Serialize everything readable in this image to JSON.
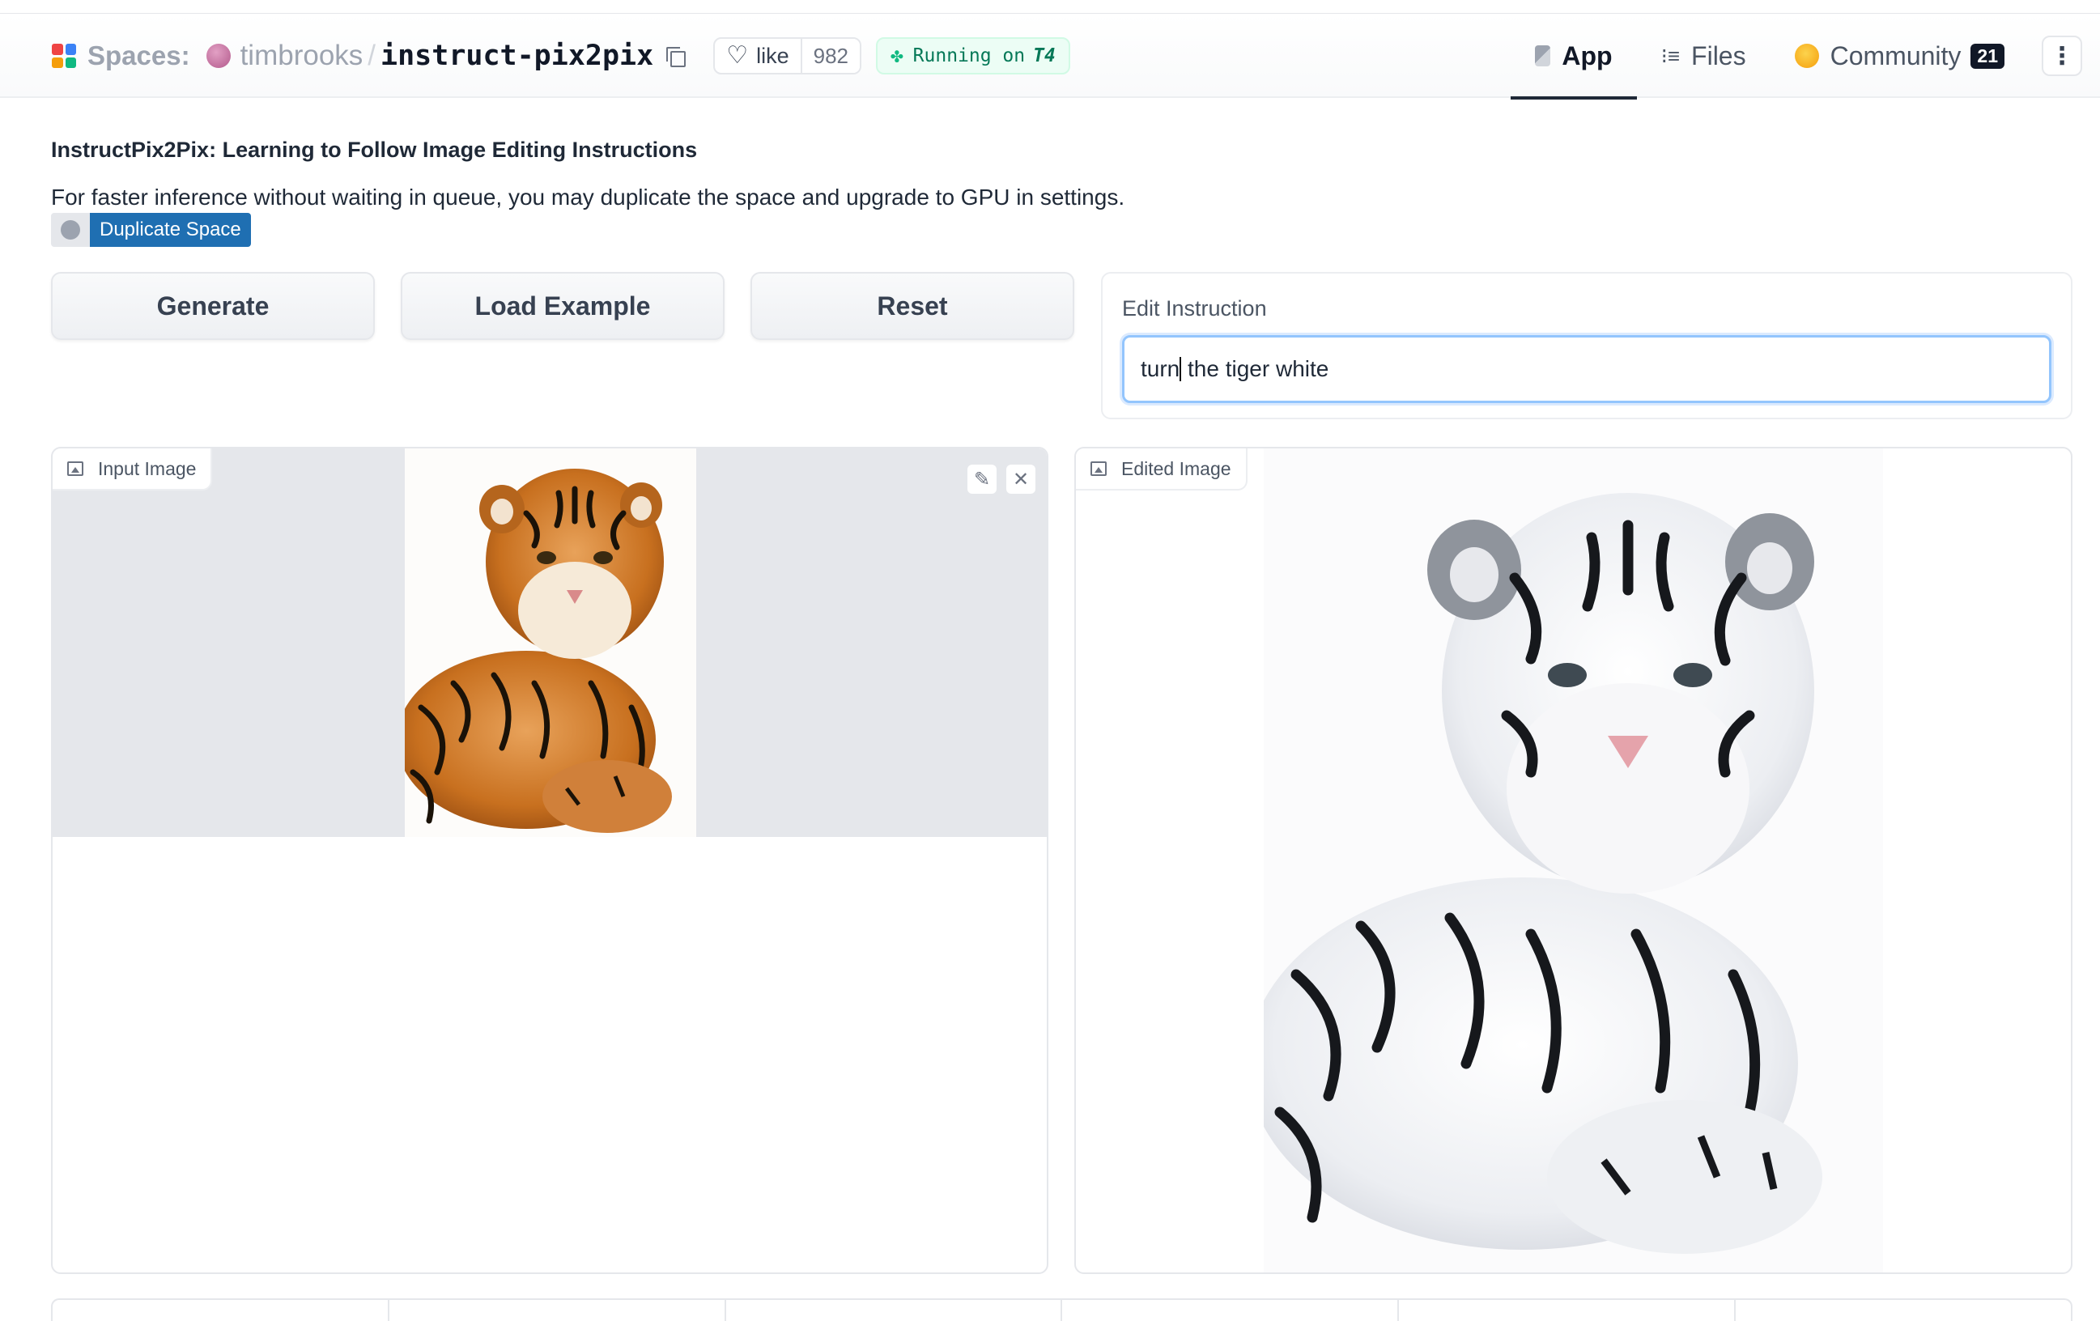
{
  "header": {
    "spaces_label": "Spaces:",
    "owner": "timbrooks",
    "separator": "/",
    "repo": "instruct-pix2pix",
    "like_label": "like",
    "like_count": "982",
    "running_label": "Running on",
    "hardware": "T4",
    "tabs": [
      {
        "label": "App",
        "icon": "cube-icon",
        "active": true
      },
      {
        "label": "Files",
        "icon": "files-icon",
        "active": false
      },
      {
        "label": "Community",
        "icon": "hugging-face-icon",
        "active": false,
        "badge": "21"
      }
    ],
    "more_icon": "more-vertical-icon"
  },
  "main": {
    "title": "InstructPix2Pix: Learning to Follow Image Editing Instructions",
    "subtitle": "For faster inference without waiting in queue, you may duplicate the space and upgrade to GPU in settings.",
    "duplicate_badge": "Duplicate Space",
    "buttons": {
      "generate": "Generate",
      "load_example": "Load Example",
      "reset": "Reset"
    },
    "instruction": {
      "label": "Edit Instruction",
      "value_before_caret": "turn",
      "value_after_caret": " the tiger white"
    },
    "input_image": {
      "label": "Input Image"
    },
    "edited_image": {
      "label": "Edited Image"
    }
  },
  "colors": {
    "accent_blue": "#1f6fb2",
    "running_green": "#047857",
    "focus_ring": "#93c5fd"
  }
}
